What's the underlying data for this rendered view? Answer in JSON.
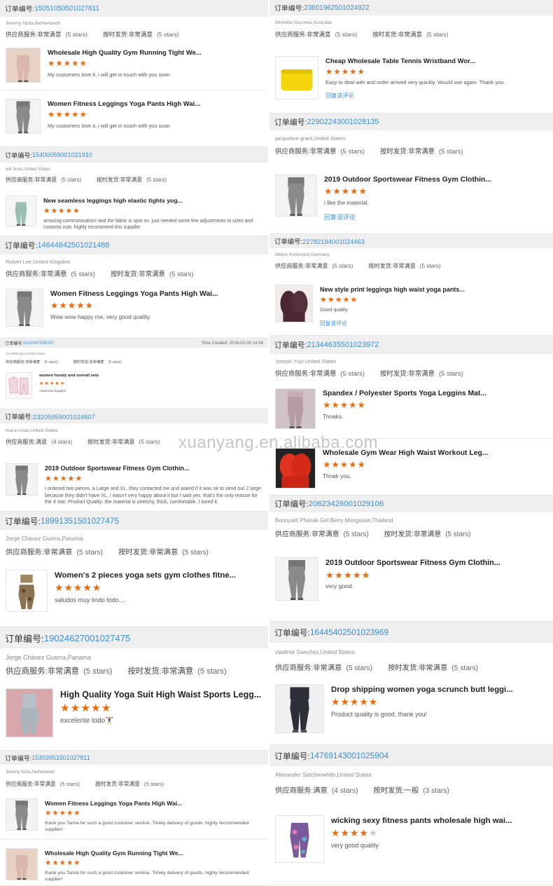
{
  "labels": {
    "order_no": "订单编号:",
    "supplier_service": "供应商服务:",
    "on_time_delivery": "按时发货:",
    "reply": "回复该评论",
    "time_created": "Time Created: 2018-02-06 14:36"
  },
  "left": [
    {
      "order": "15051050501027811",
      "buyer": "Jeremy Nzita,Netherlands",
      "svc_val": "非常满意",
      "svc_stars": "(5 stars)",
      "del_val": "非常满意",
      "del_stars": "(5 stars)",
      "items": [
        {
          "title": "Wholesale High Quality Gym Running Tight We...",
          "stars": 5,
          "comment": "My customers love it, i will get in touch with you soon",
          "thumb": "pink-leggings-icon"
        },
        {
          "title": "Women Fitness Leggings Yoga Pants High Wai...",
          "stars": 5,
          "comment": "My customers love it, i will get in touch with you soon",
          "thumb": "grey-leggings-icon"
        }
      ]
    },
    {
      "order": "15400059001021910",
      "buyer": "will hicks,United States",
      "svc_val": "非常满意",
      "svc_stars": "(5 stars)",
      "del_val": "非常满意",
      "del_stars": "(5 stars)",
      "items": [
        {
          "title": "New seamless leggings high elastic tights yog...",
          "stars": 5,
          "comment": "amazing communication! and the fabric is spot on. just needed some few adjustments to sizes and customs cuts. highly recommend this supplier",
          "thumb": "mint-leggings-icon"
        }
      ]
    },
    {
      "order": "14644842501021488",
      "buyer": "Robert Lee,United Kingdom",
      "svc_val": "非常满意",
      "svc_stars": "(5 stars)",
      "del_val": "非常满意",
      "del_stars": "(5 stars)",
      "items": [
        {
          "title": "Women Fitness Leggings Yoga Pants High Wai...",
          "stars": 5,
          "comment": "Wow wow happy me, very good quality.",
          "thumb": "grey-leggings-icon"
        }
      ]
    },
    {
      "order": "8102087585197",
      "buyer": "Joe Washington,United States",
      "svc_val": "非常满意",
      "svc_stars": "(5 stars)",
      "del_val": "非常满意",
      "del_stars": "(5 stars)",
      "items": [
        {
          "title": "women hoody and overall sets",
          "stars": 5,
          "comment": "Awesome Supplier",
          "thumb": "hoodie-set-icon"
        }
      ]
    },
    {
      "order": "23205959001024607",
      "buyer": "maria rosas,United States",
      "svc_val": "满意",
      "svc_stars": "(4 stars)",
      "del_val": "非常满意",
      "del_stars": "(5 stars)",
      "items": [
        {
          "title": "2019 Outdoor Sportswear Fitness Gym Clothin...",
          "stars": 5,
          "comment": "I ordered two pieces, a Large and XL. they contacted me and asked if it was ok to send out 2 large because they didn't have XL, I wasn't very happy about it but I said yes. that's the only reason for the 4 star. Product Quality: the material is stretchy, thick, comfortable. I loved it.",
          "thumb": "grey-leggings-icon",
          "reply": true
        }
      ]
    },
    {
      "order": "18991351501027475",
      "buyer": "Jorge Chávez Guerra,Panama",
      "svc_val": "非常满意",
      "svc_stars": "(5 stars)",
      "del_val": "非常满意",
      "del_stars": "(5 stars)",
      "items": [
        {
          "title": "Women's 2 pieces yoga sets gym clothes fitne...",
          "stars": 5,
          "comment": "saludos muy lindo  todo....",
          "thumb": "camo-set-icon"
        }
      ]
    },
    {
      "order": "19024627001027475",
      "buyer": "Jorge Chávez Guerra,Panama",
      "svc_val": "非常满意",
      "svc_stars": "(5 stars)",
      "del_val": "非常满意",
      "del_stars": "(5 stars)",
      "items": [
        {
          "title": "High Quality Yoga Suit High Waist Sports Legg...",
          "stars": 5,
          "comment": "excelente todo🏋‍♀",
          "thumb": "pink-suit-icon"
        }
      ]
    },
    {
      "order": "15303951501027811",
      "buyer": "Jeremy Nzita,Netherlands",
      "svc_val": "非常满意",
      "svc_stars": "(5 stars)",
      "del_val": "非常满意",
      "del_stars": "(5 stars)",
      "items": [
        {
          "title": "Women Fitness Leggings Yoga Pants High Wai...",
          "stars": 5,
          "comment": "thank you Tamia for such a good customer service. Timely delivery of goods. highly recommended supplier!",
          "thumb": "grey-leggings-icon"
        },
        {
          "title": "Wholesale High Quality Gym Running Tight We...",
          "stars": 5,
          "comment": "thank you Tamia for such a good customer service. Timely delivery of goods. highly recommended supplier!",
          "thumb": "pink-leggings-icon"
        }
      ]
    }
  ],
  "right": [
    {
      "order": "23601962501024922",
      "buyer": "Michelle Gezorke,Australia",
      "svc_val": "非常满意",
      "svc_stars": "(5 stars)",
      "del_val": "非常满意",
      "del_stars": "(5 stars)",
      "items": [
        {
          "title": "Cheap Wholesale Table Tennis Wristband Wor...",
          "stars": 5,
          "comment": "Easy to deal with and order arrived very quickly.  Would use again.  Thank you.",
          "thumb": "yellow-wristband-icon",
          "reply": true
        }
      ]
    },
    {
      "order": "22902243001028135",
      "buyer": "jacqueline grant,United States",
      "svc_val": "非常满意",
      "svc_stars": "(5 stars)",
      "del_val": "非常满意",
      "del_stars": "(5 stars)",
      "items": [
        {
          "title": "2019 Outdoor Sportswear Fitness Gym Clothin...",
          "stars": 5,
          "comment": "i like the material.",
          "thumb": "grey-leggings-icon",
          "reply": true
        }
      ]
    },
    {
      "order": "22782194001024463",
      "buyer": "Melvin Kohlrusch,Germany",
      "svc_val": "非常满意",
      "svc_stars": "(5 stars)",
      "del_val": "非常满意",
      "del_stars": "(5 stars)",
      "items": [
        {
          "title": "New style print leggings high waist yoga pants...",
          "stars": 5,
          "comment": "Good quality",
          "thumb": "plum-leggings-icon",
          "reply": true
        }
      ]
    },
    {
      "order": "21344635501023972",
      "buyer": "Joseph Yuyi,United States",
      "svc_val": "非常满意",
      "svc_stars": "(5 stars)",
      "del_val": "非常满意",
      "del_stars": "(5 stars)",
      "items": [
        {
          "title": "Spandex / Polyester Sports Yoga Leggins Mat...",
          "stars": 5,
          "comment": "Thnaks.",
          "thumb": "mauve-leggings-icon"
        },
        {
          "title": "Wholesale Gym Wear High Waist Workout Leg...",
          "stars": 5,
          "comment": "Thnak you.",
          "thumb": "red-leggings-icon"
        }
      ]
    },
    {
      "order": "20623426001029106",
      "buyer": "Boonyarit Phanak Get Berry Mongoose,Thailand",
      "svc_val": "非常满意",
      "svc_stars": "(5 stars)",
      "del_val": "非常满意",
      "del_stars": "(5 stars)",
      "items": [
        {
          "title": "2019 Outdoor Sportswear Fitness Gym Clothin...",
          "stars": 5,
          "comment": "very good.",
          "thumb": "grey-leggings-icon"
        }
      ]
    },
    {
      "order": "16445402501023969",
      "buyer": "vladimir Sanchez,United States",
      "svc_val": "非常满意",
      "svc_stars": "(5 stars)",
      "del_val": "非常满意",
      "del_stars": "(5 stars)",
      "items": [
        {
          "title": "Drop shipping women yoga scrunch butt leggi...",
          "stars": 5,
          "comment": "Product quality is good, thank you!",
          "thumb": "black-leggings-icon"
        }
      ]
    },
    {
      "order": "14769143001025904",
      "buyer": "Alexander Satcherwhite,United States",
      "svc_val": "满意",
      "svc_stars": "(4 stars)",
      "del_val": "一般",
      "del_stars": "(3 stars)",
      "items": [
        {
          "title": "wicking sexy fitness pants wholesale high wai...",
          "stars": 4,
          "comment": "very good quality",
          "thumb": "print-leggings-icon"
        }
      ]
    }
  ],
  "watermark": "xuanyang.en.alibaba.com",
  "colors": {
    "accent_blue": "#3a8ed8",
    "star_orange": "#f06a0a",
    "header_grey": "#efefef"
  }
}
